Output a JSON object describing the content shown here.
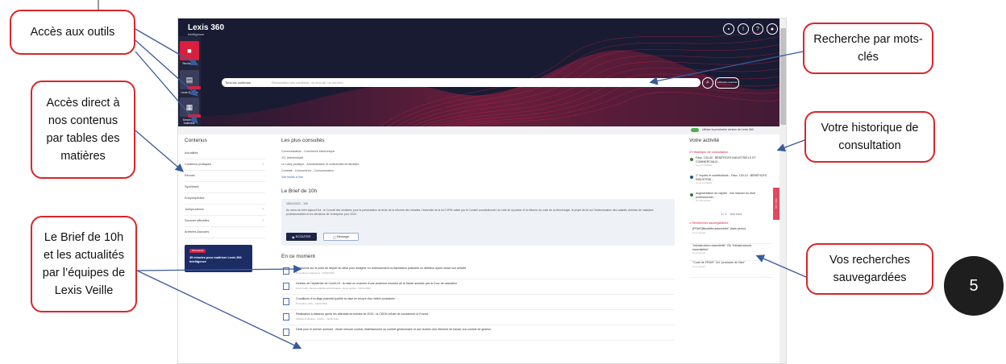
{
  "callouts": {
    "outils": "Accès aux outils",
    "contenus": "Accès direct à nos contenus par tables des matières",
    "brief": "Le Brief de 10h et les actualités par l’équipes de Lexis Veille",
    "recherche": "Recherche par mots-clés",
    "historique": "Votre historique de consultation",
    "sauvegardees": "Vos recherches sauvegardées"
  },
  "step_number": "5",
  "app": {
    "brand": "Lexis 360",
    "brand_sub": "Intelligence",
    "rail": {
      "recherche": "Recherche",
      "lexis_explore": "Lexis Explore",
      "simulateur": "Simulateur indemnit."
    },
    "search": {
      "scope": "Tous les contenus",
      "placeholder": "Recherchez des contenus, un mot-clé, un numéro",
      "advanced": "recherche avancée"
    },
    "version_toggle": "Utiliser la prochaine version de Lexis 360",
    "left_title": "Contenus",
    "nav_items": [
      "Actualités",
      "Contenus pratiques",
      "Revues",
      "Synthèses",
      "Encyclopédies",
      "Jurisprudence",
      "Sources officielles",
      "Arrêtées Associés"
    ],
    "promo_tag": "Nouveauté",
    "promo_text": "45 minutes pour maîtriser Lexis 360 Intelligence",
    "consultes_title": "Les plus consultés",
    "consultes": [
      "Communication - Commerce électronique",
      "JCl. Administratif",
      "Le Lamy juridique - Administration et collectivités territoriales",
      "Contrats - Concurrence - Consommation"
    ],
    "voir_tout": "Voir moins à Voir",
    "brief_title": "Le Brief de 10h",
    "brief_date": "18/01/2022 - 10h",
    "brief_text": "Au menu du brief aujourd'hui : le Conseil des ministres pour la présentation du texte de la réforme des retraites, l'essentiel de la loi 2.0PM validé par le Conseil constitutionnel, du côté de la justice et la réforme du code de la déontologie, le projet de loi sur l'indemnisation des salariés victimes de maladies professionnelles et les décisions de l'entreprise pour 2022.",
    "ecouter": "ECOUTER",
    "message": "Message",
    "en_ce_moment_title": "En ce moment",
    "news": [
      {
        "title": "Précisions sur le point de départ du délai pour assigner en redressement ou liquidation judiciaire un débiteur ayant cessé son activité",
        "meta": "Procédures collectives - 19/01/2022"
      },
      {
        "title": "Gestion de l'épidémie de Covid-19 : la mise en examen d'une ancienne ministre de la Santé annulée par la Cour de cassation",
        "meta": "Droit Public, Responsabilité administrative, droits publics - 19/01/2022"
      },
      {
        "title": "Conditions d'un litige potentiel justifié la mise en œuvre d'un référé probatoire",
        "meta": "Procédure civile - 19/01/2022"
      },
      {
        "title": "Réalisation à distance après les attentats terroristes de 2015 : la CEDH refuse de condamner la France",
        "meta": "Libertés publiques, Justice - 19/01/2022"
      },
      {
        "title": "Délai pour le dernier avenant : étude mesure contrat, établissement ou contrat gestionnaire et aux durées d'un élément de travail, son contrat de gestion",
        "meta": ""
      }
    ],
    "activite_title": "Votre activité",
    "historique_head": "Historique de consultation",
    "historique": [
      {
        "title": "Fasc. 130-40 : BÉNÉFICES INDUSTRIELS ET COMMERCIAUX...",
        "meta": "Il y a 3 minutes"
      },
      {
        "title": "1° Impôts et contributions - Fasc. 130-10 : BÉNÉFICES INDUSTRIE...",
        "meta": "Il y a 4 minutes"
      },
      {
        "title": "Augmentation de capital - Voir manuel du droit professionnel...",
        "meta": "Il y a 5 heures"
      }
    ],
    "pager": "1 / 1",
    "voir_tout_right": "Voir tout",
    "sauvegardes_head": "Recherches sauvegardées",
    "sauvegardes": [
      {
        "title": "[FRAIS]fiscalités assemblés\" (frais perso)",
        "meta": "Il y a 4 jours"
      },
      {
        "title": "\"Infrastructure essentielle\" OU \"Infrastructures essentielles\"",
        "meta": "Il y a 4 jours"
      },
      {
        "title": "\"Code de FRAIS\" OU \"protocole de Nice\"",
        "meta": "Il y a 4 jours"
      }
    ],
    "feedback": "Votre avis"
  }
}
